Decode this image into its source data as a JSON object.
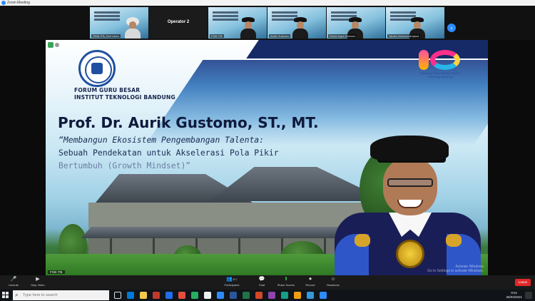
{
  "window": {
    "title": "Zoom Meeting"
  },
  "gallery": {
    "tiles": [
      {
        "name": "GBM-ITB_Dwi Larso"
      },
      {
        "name": "Operator 2"
      },
      {
        "name": "FGB ITB"
      },
      {
        "name": "Aurik Gustomo"
      },
      {
        "name": "Edwin Agus Buwono"
      },
      {
        "name": "Taufan Marhaendrajana"
      }
    ]
  },
  "slide": {
    "org_line1": "FORUM GURU BESAR",
    "org_line2": "INSTITUT TEKNOLOGI BANDUNG",
    "logo_caption": "Bandung Great Teacher Institut Teknologi Bandung",
    "speaker_title": "Prof. Dr. Aurik Gustomo, ST., MT.",
    "talk_line1": "“Membangun Ekosistem Pengembangan Talenta:",
    "talk_line2": "Sebuah Pendekatan untuk Akselerasi Pola Pikir",
    "talk_line3": "Bertumbuh (Growth Mindset)”",
    "presenter_tag": "FGB ITB",
    "watermark_line1": "Activate Windows",
    "watermark_line2": "Go to Settings to activate Windows."
  },
  "toolbar": {
    "items": [
      {
        "label": "Unmute",
        "icon": "mic-icon"
      },
      {
        "label": "Stop Video",
        "icon": "video-icon"
      },
      {
        "label": "Participants",
        "icon": "participants-icon",
        "count": "467"
      },
      {
        "label": "Chat",
        "icon": "chat-icon"
      },
      {
        "label": "Share Screen",
        "icon": "share-icon"
      },
      {
        "label": "Record",
        "icon": "record-icon"
      },
      {
        "label": "Reactions",
        "icon": "reactions-icon"
      }
    ],
    "end_label": "Leave"
  },
  "taskbar": {
    "search_placeholder": "Type here to search",
    "clock_time": "9:51",
    "clock_date": "26/03/2021"
  },
  "colors": {
    "zoom_blue": "#2d8cff",
    "slide_navy": "#16234b",
    "end_red": "#e02828",
    "share_green": "#27c24c"
  }
}
